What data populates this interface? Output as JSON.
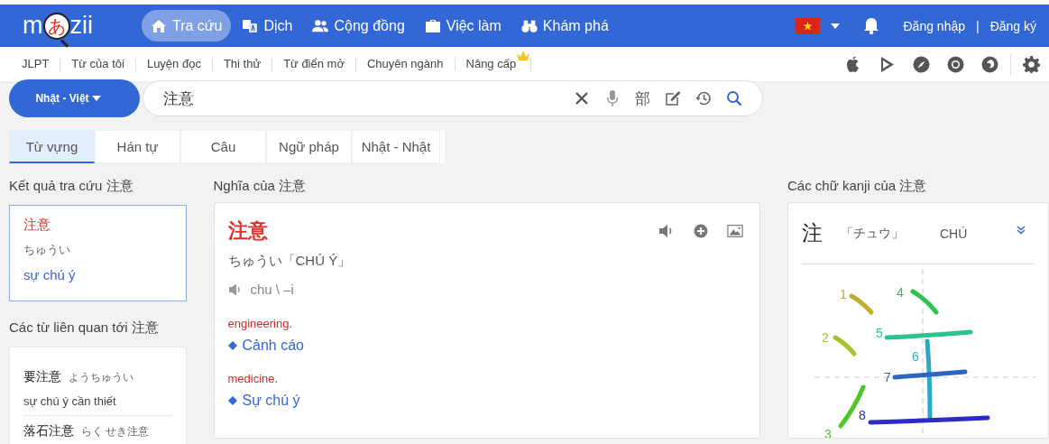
{
  "logo": {
    "before": "m",
    "kana": "あ",
    "after": "zii"
  },
  "nav": [
    {
      "label": "Tra cứu",
      "selected": true
    },
    {
      "label": "Dịch",
      "selected": false
    },
    {
      "label": "Cộng đồng",
      "selected": false
    },
    {
      "label": "Việc làm",
      "selected": false
    },
    {
      "label": "Khám phá",
      "selected": false
    }
  ],
  "account": {
    "login": "Đăng nhập",
    "separator": "|",
    "register": "Đăng ký"
  },
  "subnav": [
    {
      "label": "JLPT",
      "badge": false
    },
    {
      "label": "Từ của tôi",
      "badge": false
    },
    {
      "label": "Luyện đọc",
      "badge": false
    },
    {
      "label": "Thi thử",
      "badge": false
    },
    {
      "label": "Từ điển mở",
      "badge": false
    },
    {
      "label": "Chuyên ngành",
      "badge": false
    },
    {
      "label": "Nâng cấp",
      "badge": true
    }
  ],
  "search": {
    "language": "Nhật - Việt",
    "value": "注意",
    "radical_button": "部"
  },
  "tabs": [
    {
      "label": "Từ vựng",
      "selected": true
    },
    {
      "label": "Hán tự",
      "selected": false
    },
    {
      "label": "Câu",
      "selected": false
    },
    {
      "label": "Ngữ pháp",
      "selected": false
    },
    {
      "label": "Nhật - Nhật",
      "selected": false
    }
  ],
  "results": {
    "heading": "Kết quả tra cứu 注意",
    "word": "注意",
    "reading": "ちゅうい",
    "meaning": "sự chú ý"
  },
  "related": {
    "heading": "Các từ liên quan tới 注意",
    "items": [
      {
        "word": "要注意",
        "reading": "ようちゅうい",
        "meaning": "sự chú ý cần thiết"
      },
      {
        "word": "落石注意",
        "reading": "らく せき注意"
      }
    ]
  },
  "definition": {
    "heading": "Nghĩa của 注意",
    "word": "注意",
    "reading": "ちゅうい「CHÚ Ý」",
    "pronunciation": "chu \\ –i",
    "senses": [
      {
        "field": "engineering.",
        "meaning": "Cảnh cáo"
      },
      {
        "field": "medicine.",
        "meaning": "Sự chú ý"
      }
    ]
  },
  "kanji": {
    "heading": "Các chữ kanji của 注意",
    "character": "注",
    "onyomi": "「チュウ」",
    "hanviet": "CHÚ",
    "strokes": [
      {
        "number": "1",
        "color": "#c4ac2c"
      },
      {
        "number": "2",
        "color": "#a4c42c"
      },
      {
        "number": "3",
        "color": "#52c42c"
      },
      {
        "number": "4",
        "color": "#2cc44c"
      },
      {
        "number": "5",
        "color": "#2cc48e"
      },
      {
        "number": "6",
        "color": "#2caac4"
      },
      {
        "number": "7",
        "color": "#2c64c4"
      },
      {
        "number": "8",
        "color": "#2c2cc4"
      }
    ]
  }
}
